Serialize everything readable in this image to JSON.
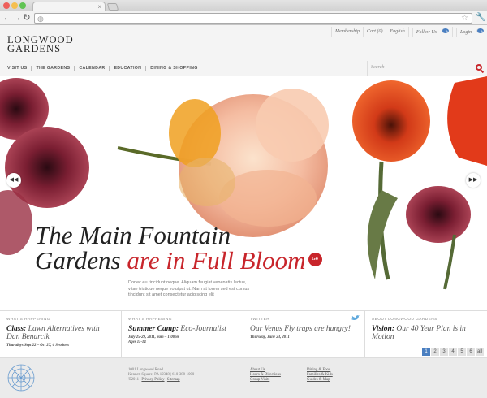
{
  "browser": {
    "tab_close": "×"
  },
  "utility_nav": [
    "Membership",
    "Cart (0)",
    "English",
    "Follow Us",
    "Login"
  ],
  "logo": {
    "line1": "LONGWOOD",
    "line2": "GARDENS"
  },
  "main_nav": [
    "VISIT US",
    "THE GARDENS",
    "CALENDAR",
    "EDUCATION",
    "DINING & SHOPPING"
  ],
  "search": {
    "placeholder": "Search"
  },
  "hero": {
    "headline_line1": "The Main Fountain",
    "headline_line2_a": "Gardens ",
    "headline_line2_b": "are in Full Bloom",
    "go_label": "Go",
    "body_line1": "Donec eu tincidunt neque. Aliquam feugiat venenatis lectus,",
    "body_line2": "vitae tristique neque volutpat ut. Nam at lorem sed est cursus",
    "body_line3": "tincidunt sit amet consectetur adipiscing elit",
    "prev": "◀◀",
    "next": "▶▶"
  },
  "news": [
    {
      "category": "WHAT'S HAPPENING",
      "title_bold": "Class:",
      "title_rest": " Lawn Alternatives with Dan Benarcik",
      "date": "Thursdays Sept 22 – Oct 27, 6 Sessions",
      "date2": ""
    },
    {
      "category": "WHAT'S HAPPENING",
      "title_bold": "Summer Camp:",
      "title_rest": " Eco-Journalist",
      "date": "July 25-29, 2011, 9am – 1:00pm",
      "date2": "Ages 11-14"
    },
    {
      "category": "TWITTER",
      "title_bold": "",
      "title_rest": "Our Venus Fly traps are hungry!",
      "date": "Thursday, June 23, 2011",
      "date2": ""
    },
    {
      "category": "ABOUT LONGWOOD GARDENS",
      "title_bold": "Vision:",
      "title_rest": " Our 40 Year Plan is in Motion",
      "date": "",
      "date2": ""
    }
  ],
  "pager": [
    "1",
    "2",
    "3",
    "4",
    "5",
    "6",
    "all"
  ],
  "footer": {
    "address_line1": "1001 Longwood Road",
    "address_line2": "Kennett Square, PA 19348 | 610-388-1000",
    "copyright": "©2011",
    "privacy": "Privacy Policy",
    "sitemap": "Sitemap",
    "links_col1": [
      "About Us",
      "Hours & Directions",
      "Group Visits"
    ],
    "links_col2": [
      "Dining & Food",
      "Families & Kids",
      "Guides & Map"
    ]
  },
  "colors": {
    "brand_red": "#c8252b",
    "accent_blue": "#4a7fc1"
  }
}
